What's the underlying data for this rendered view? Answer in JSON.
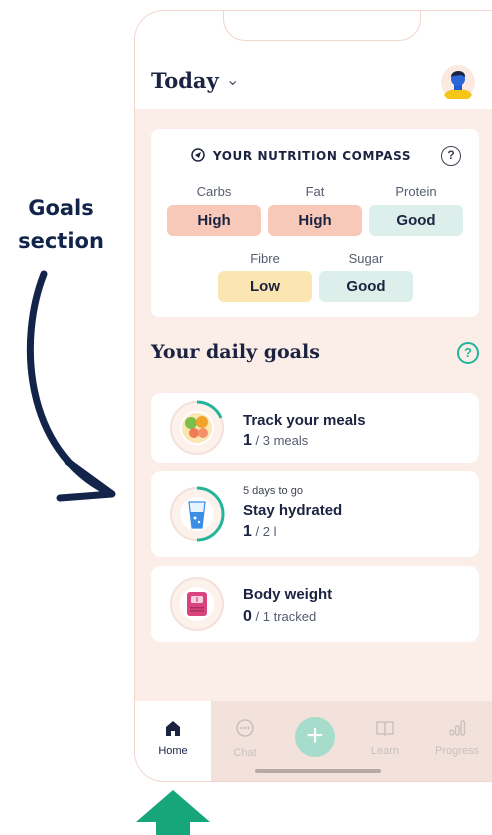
{
  "annotation": {
    "label_line1": "Goals",
    "label_line2": "section"
  },
  "header": {
    "title": "Today",
    "avatar_icon": "user-avatar-icon"
  },
  "compass": {
    "title": "YOUR NUTRITION COMPASS",
    "help": "?",
    "items": [
      {
        "label": "Carbs",
        "value": "High",
        "color": "#f8c9b9"
      },
      {
        "label": "Fat",
        "value": "High",
        "color": "#f8c9b9"
      },
      {
        "label": "Protein",
        "value": "Good",
        "color": "#dcefeb"
      },
      {
        "label": "Fibre",
        "value": "Low",
        "color": "#fbe6b2"
      },
      {
        "label": "Sugar",
        "value": "Good",
        "color": "#dcefeb"
      }
    ]
  },
  "goals": {
    "title": "Your daily goals",
    "help": "?",
    "items": [
      {
        "pre": "",
        "name": "Track your meals",
        "current": "1",
        "total": " / 3 meals",
        "icon": "meal-plate-icon"
      },
      {
        "pre": "5 days to go",
        "name": "Stay hydrated",
        "current": "1",
        "total": " / 2 l",
        "icon": "water-glass-icon"
      },
      {
        "pre": "",
        "name": "Body weight",
        "current": "0",
        "total": " / 1 tracked",
        "icon": "scale-icon"
      }
    ]
  },
  "nav": {
    "items": [
      {
        "label": "Home",
        "icon": "home-icon",
        "active": true
      },
      {
        "label": "Chat",
        "icon": "chat-icon"
      },
      {
        "label": "+",
        "icon": "add-icon"
      },
      {
        "label": "Learn",
        "icon": "book-icon"
      },
      {
        "label": "Progress",
        "icon": "bar-chart-icon"
      }
    ]
  },
  "colors": {
    "accent": "#22b59a",
    "background": "#fbeee9",
    "arrow": "#12244a",
    "up_arrow": "#17a57a"
  }
}
